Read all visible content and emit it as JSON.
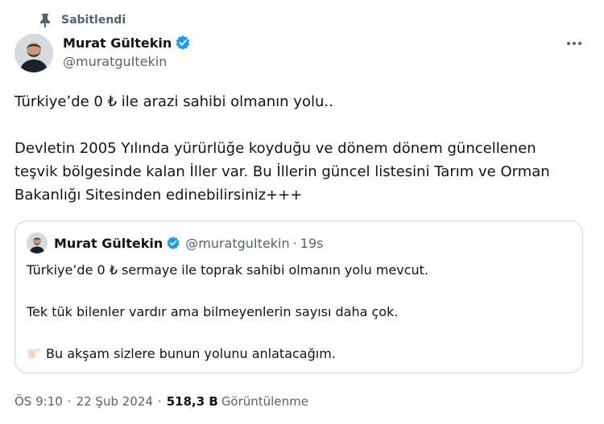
{
  "pinned": {
    "label": "Sabitlendi"
  },
  "author": {
    "name": "Murat Gültekin",
    "handle": "@muratguItekin"
  },
  "tweet": {
    "lines": [
      "Türkiye’de 0 ₺ ile arazi sahibi olmanın yolu..",
      "Devletin 2005 Yılında yürürlüğe koyduğu ve dönem dönem güncellenen",
      "teşvik bölgesinde kalan İller var. Bu İllerin güncel listesini Tarım ve Orman",
      "Bakanlığı Sitesinden edinebilirsiniz+++"
    ]
  },
  "quote": {
    "name": "Murat Gültekin",
    "handle": "@muratguItekin",
    "dot": "·",
    "time": "19s",
    "lines": [
      "Türkiye’de 0 ₺ sermaye ile toprak sahibi olmanın yolu mevcut.",
      "Tek tük bilenler vardır ama bilmeyenlerin sayısı daha çok.",
      "Bu akşam sizlere bunun yolunu anlatacağım."
    ]
  },
  "meta": {
    "time": "ÖS 9:10",
    "sep1": "·",
    "date": "22 Şub 2024",
    "sep2": "·",
    "views": "518,3 B",
    "views_label": "Görüntülenme"
  },
  "colors": {
    "verified": "#1d9bf0",
    "secondary_text": "#536471",
    "border": "#cfd9de"
  },
  "icons": {
    "pinned": "pin-icon",
    "verified": "verified-badge-icon",
    "more": "more-icon",
    "emoji": "backhand-index-pointing-right-emoji"
  }
}
